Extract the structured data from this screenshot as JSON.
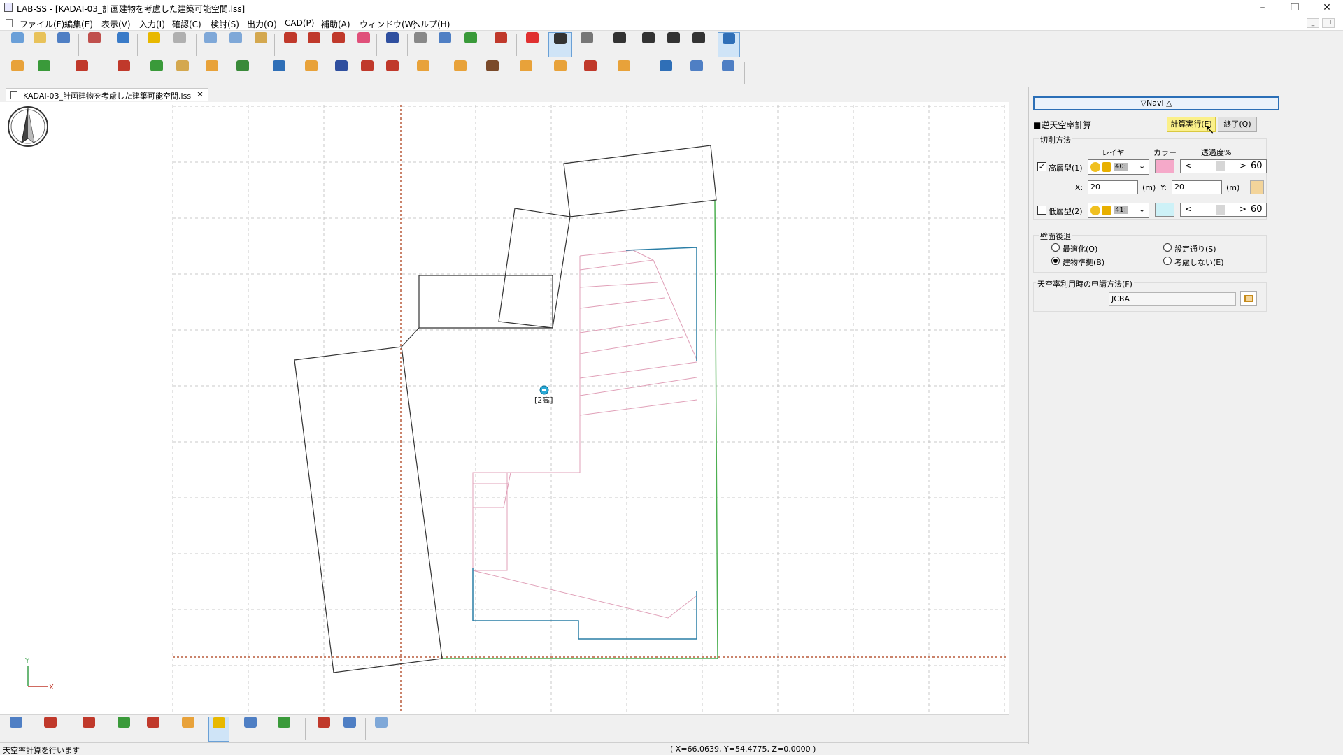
{
  "window": {
    "title": "LAB-SS - [KADAI-03_計画建物を考慮した建築可能空間.lss]",
    "minimize": "–",
    "restore": "❐",
    "close": "✕"
  },
  "menu": [
    "ファイル(F)",
    "編集(E)",
    "表示(V)",
    "入力(I)",
    "確認(C)",
    "検討(S)",
    "出力(O)",
    "CAD(P)",
    "補助(A)",
    "ウィンドウ(W)",
    "ヘルプ(H)"
  ],
  "mdi": {
    "minimize": "_",
    "restore": "❐"
  },
  "toolbar1": [
    {
      "label": "新規",
      "color": "#6a9fd8"
    },
    {
      "label": "開く",
      "color": "#e8c25a"
    },
    {
      "label": "保存",
      "color": "#4f7fc4"
    },
    {
      "label": "管理",
      "color": "#c0504d"
    },
    {
      "label": "Ver",
      "color": "#3a7bc8"
    },
    {
      "label": "Undo",
      "color": "#e8b800"
    },
    {
      "label": "Redo",
      "color": "#b0b0b0"
    },
    {
      "label": "切取",
      "color": "#7fa8d8"
    },
    {
      "label": "コピー",
      "color": "#7fa8d8"
    },
    {
      "label": "貼付",
      "color": "#d4a84f"
    },
    {
      "label": "移動",
      "color": "#c0392b"
    },
    {
      "label": "複写",
      "color": "#c0392b"
    },
    {
      "label": "回転",
      "color": "#c0392b"
    },
    {
      "label": "削除",
      "color": "#e0507a"
    },
    {
      "label": "属性",
      "color": "#2f4f9f"
    },
    {
      "label": "パン",
      "color": "#888888"
    },
    {
      "label": "拡大",
      "color": "#4f7fc4"
    },
    {
      "label": "視点",
      "color": "#3a9a3a"
    },
    {
      "label": "レイヤ",
      "color": "#c0392b"
    },
    {
      "label": "任意",
      "color": "#e03030"
    },
    {
      "label": "端・交",
      "color": "#333333"
    },
    {
      "label": "ｸﾞﾘｯﾄﾞ",
      "color": "#777777"
    },
    {
      "label": "円中心",
      "color": "#333333"
    },
    {
      "label": "垂直",
      "color": "#333333"
    },
    {
      "label": "線上",
      "color": "#333333"
    },
    {
      "label": "面上",
      "color": "#333333"
    },
    {
      "label": "拘束",
      "color": "#2f6fb7"
    }
  ],
  "toolbar2": [
    {
      "label": "概要",
      "color": "#e8a23a"
    },
    {
      "label": "敷地",
      "color": "#3a9a3a"
    },
    {
      "label": "斜線地盤",
      "color": "#c0392b"
    },
    {
      "label": "日影地盤",
      "color": "#c0392b"
    },
    {
      "label": "道路",
      "color": "#3a9a3a"
    },
    {
      "label": "みなし",
      "color": "#d4a84f"
    },
    {
      "label": "用途",
      "color": "#e8a23a"
    },
    {
      "label": "地形",
      "color": "#3a8a3a"
    },
    {
      "label": "建物",
      "color": "#2f6fb7"
    },
    {
      "label": "部屋",
      "color": "#e8a23a"
    },
    {
      "label": "開口",
      "color": "#2f4f9f"
    },
    {
      "label": "屋根",
      "color": "#c0392b"
    },
    {
      "label": "階高",
      "color": "#c0392b"
    },
    {
      "label": "自動生成",
      "color": "#e8a23a"
    },
    {
      "label": "天空点",
      "color": "#e8a23a"
    },
    {
      "label": "天空窓",
      "color": "#7a4a2a"
    },
    {
      "label": "測定線",
      "color": "#e8a23a"
    },
    {
      "label": "日影点",
      "color": "#e8a23a"
    },
    {
      "label": "斜線",
      "color": "#c0392b"
    },
    {
      "label": "平均地盤",
      "color": "#e8a23a"
    },
    {
      "label": "立断面",
      "color": "#2f6fb7"
    },
    {
      "label": "日照点",
      "color": "#4f7fc4"
    },
    {
      "label": "日照面",
      "color": "#4f7fc4"
    }
  ],
  "doc_tab": {
    "label": "KADAI-03_計画建物を考慮した建築可能空間.lss",
    "close": "✕"
  },
  "canvas": {
    "building_label": "[2高]",
    "axis_y": "Y",
    "axis_x": "X"
  },
  "bottom_toolbar": [
    {
      "label": "号表示",
      "color": "#4f7fc4"
    },
    {
      "label": "全表示",
      "color": "#c0392b"
    },
    {
      "label": "表示範囲",
      "color": "#c0392b"
    },
    {
      "label": "方位",
      "color": "#3a9a3a"
    },
    {
      "label": "座標",
      "color": "#c0392b"
    },
    {
      "label": "座軸",
      "color": "#e8a23a"
    },
    {
      "label": "真北",
      "color": "#e8b800"
    },
    {
      "label": "ｸﾞﾘｯﾄﾞ",
      "color": "#4f7fc4"
    },
    {
      "label": "ｵﾌﾞｼﾞｪｸﾄ",
      "color": "#3a9a3a"
    },
    {
      "label": "ﾄﾚｰｽ",
      "color": "#c0392b"
    },
    {
      "label": "番号",
      "color": "#4f7fc4"
    },
    {
      "label": "印刷",
      "color": "#7fa8d8"
    }
  ],
  "status": {
    "message": "天空率計算を行います",
    "coords": "( X=66.0639, Y=54.4775, Z=0.0000 )"
  },
  "panel": {
    "navi_header": "▽Navi △",
    "section_title": "■逆天空率計算",
    "run_button": "計算実行(E)",
    "end_button": "終了(Q)",
    "cut_method_label": "切削方法",
    "col_layer": "レイヤ",
    "col_color": "カラー",
    "col_transparency": "透過度%",
    "high": {
      "checked": true,
      "label": "高層型(1)",
      "layer": "40:",
      "color": "#f5a9c9",
      "transparency": "60",
      "x_label": "X:",
      "x_value": "20",
      "x_unit": "(m)",
      "y_label": "Y:",
      "y_value": "20",
      "y_unit": "(m)"
    },
    "low": {
      "checked": false,
      "label": "低層型(2)",
      "layer": "41:",
      "color": "#cdf1f7",
      "transparency": "60"
    },
    "wall_setback_label": "壁面後退",
    "radio": {
      "optimize": "最適化(O)",
      "building": "建物準拠(B)",
      "setting": "設定通り(S)",
      "ignore": "考慮しない(E)",
      "selected": "building"
    },
    "apply_method_label": "天空率利用時の申請方法(F)",
    "apply_method_value": "JCBA"
  }
}
